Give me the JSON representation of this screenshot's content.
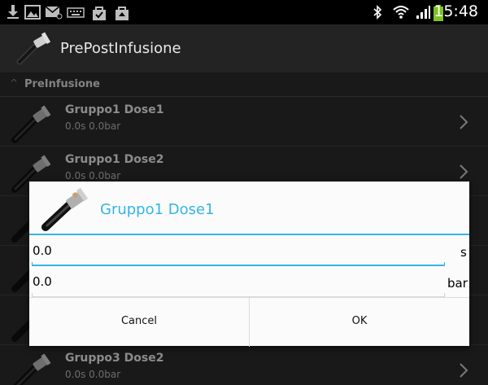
{
  "status_bar": {
    "time": "15:48",
    "left_icons": [
      "download-icon",
      "image-icon",
      "mail-icon",
      "keyboard-icon",
      "bag-icon",
      "bag-icon"
    ],
    "right_icons": [
      "bluetooth-icon",
      "wifi-icon",
      "signal-icon",
      "battery-icon"
    ]
  },
  "action_bar": {
    "title": "PrePostInfusione"
  },
  "list": {
    "section": {
      "label": "PreInfusione"
    },
    "rows": [
      {
        "title": "Gruppo1 Dose1",
        "subtitle": "0.0s  0.0bar"
      },
      {
        "title": "Gruppo1 Dose2",
        "subtitle": "0.0s  0.0bar"
      },
      {
        "title": "Gruppo3 Dose2",
        "subtitle": "0.0s  0.0bar"
      }
    ]
  },
  "dialog": {
    "title": "Gruppo1 Dose1",
    "fields": [
      {
        "value": "0.0",
        "unit": "s"
      },
      {
        "value": "0.0",
        "unit": "bar"
      }
    ],
    "cancel_label": "Cancel",
    "ok_label": "OK"
  },
  "colors": {
    "accent": "#33b5e5",
    "action_bar_bg": "#232323",
    "list_bg": "#2c2c2c",
    "dialog_bg": "#fbfbfb",
    "battery_green": "#7ec321"
  }
}
